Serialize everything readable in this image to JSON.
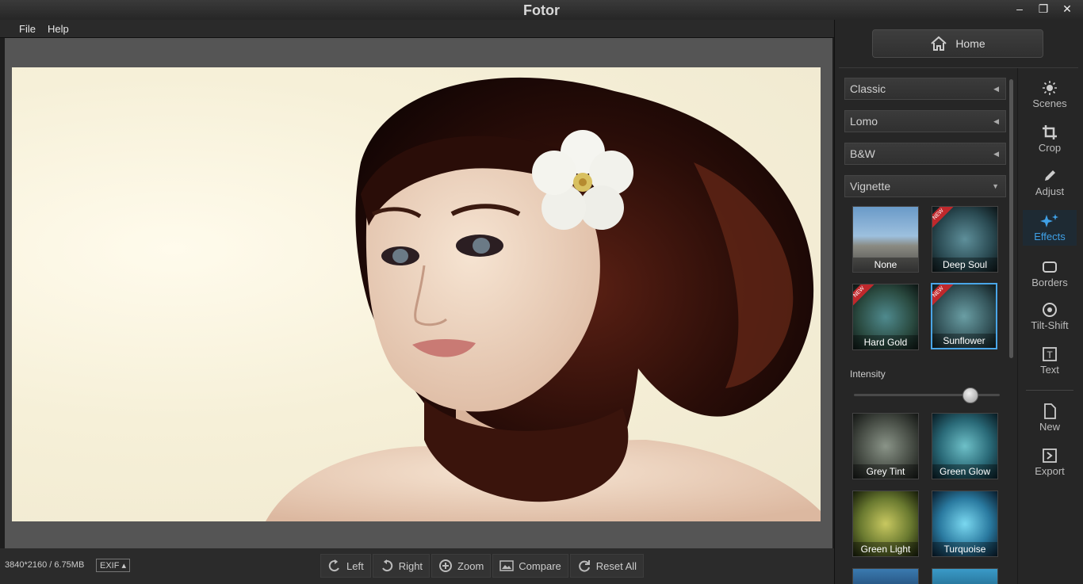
{
  "window": {
    "title": "Fotor",
    "controls": [
      "–",
      "❐",
      "✕"
    ]
  },
  "menu": {
    "file": "File",
    "help": "Help"
  },
  "status": {
    "dimensions": "3840*2160 / 6.75MB",
    "exif": "EXIF ▴"
  },
  "toolbar": {
    "left": "Left",
    "right": "Right",
    "zoom": "Zoom",
    "compare": "Compare",
    "reset": "Reset All"
  },
  "panel": {
    "home": "Home",
    "categories": [
      {
        "label": "Classic",
        "arrow": "◀"
      },
      {
        "label": "Lomo",
        "arrow": "◀"
      },
      {
        "label": "B&W",
        "arrow": "◀"
      },
      {
        "label": "Vignette",
        "arrow": "▼"
      }
    ],
    "effects": [
      {
        "label": "None",
        "new": false,
        "selected": false
      },
      {
        "label": "Deep Soul",
        "new": true,
        "selected": false
      },
      {
        "label": "Hard Gold",
        "new": true,
        "selected": false
      },
      {
        "label": "Sunflower",
        "new": true,
        "selected": true
      },
      {
        "label": "Grey Tint",
        "new": false,
        "selected": false
      },
      {
        "label": "Green Glow",
        "new": false,
        "selected": false
      },
      {
        "label": "Green Light",
        "new": false,
        "selected": false
      },
      {
        "label": "Turquoise",
        "new": false,
        "selected": false
      }
    ],
    "new_tag": "NEW",
    "intensity_label": "Intensity",
    "intensity_value": 0.8
  },
  "tools": {
    "scenes": "Scenes",
    "crop": "Crop",
    "adjust": "Adjust",
    "effects": "Effects",
    "borders": "Borders",
    "tiltshift": "Tilt-Shift",
    "text": "Text",
    "new": "New",
    "export": "Export",
    "text_glyph": "T"
  },
  "colors": {
    "accent": "#3fa0e6",
    "selected_border": "#4aa6e8",
    "new_badge": "#c0282c"
  }
}
